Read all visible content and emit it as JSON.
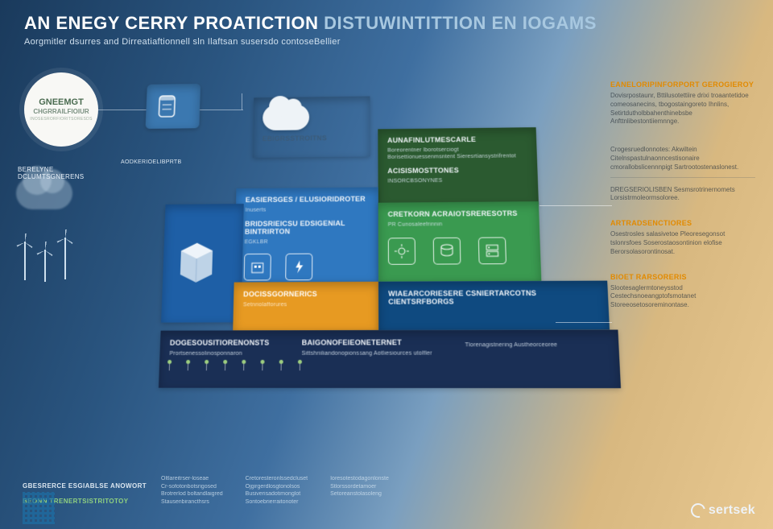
{
  "header": {
    "title_a": "AN ENEGY CERRY",
    "title_b": "PROATICTION",
    "title_c": "DISTUWINTITTION",
    "title_d": "EN IOGAMS",
    "subtitle": "Aorgmitler dsurres and Dirreatiaftionnell sln Ilaftsan susersdo contoseBellier"
  },
  "badge": {
    "line1": "GNEEMGT",
    "line2": "CHGRRAILFIOIUR",
    "line3": "INOSESRORFIORITSORESDS"
  },
  "left": {
    "cloud_label": "BERELYNE DCLUMTSGNERENS",
    "side_label": "AODKERIOELIBPRTB"
  },
  "top_cloud": {
    "label": "EBIGRSSTROITNS"
  },
  "cells": {
    "c3": {
      "h": "AUNAFINLUTMESCARLE",
      "s": "Boreorentner lborotserciogt\nBorisettionuessenmsntent\nSieresrtiansystrifrentot"
    },
    "c3b": {
      "h": "ACISISMOSTTONES",
      "s": "INSORCBSONYNES"
    },
    "c4": {
      "h": "EASIERSGES / ELUSIORIDROTER",
      "s": "Inuserts"
    },
    "c4b": {
      "h": "BRIDSRIEICSU EDSIGENIAL BINTRIRTON",
      "s": "EGKLBR"
    },
    "c5": {
      "h": "CRETKORN ACRAIOTSRERESOTRS",
      "s": "PR Cunosaleefrinnin"
    },
    "c6": {
      "h": "",
      "s": ""
    },
    "c7": {
      "h": "DOCISSGORNERICS",
      "s": "Setnriolafforures"
    },
    "c8": {
      "h": "WIAEARCORIESERE CSNIERTARCOTNS CIENTSRFBORGS",
      "s": ""
    },
    "c9a": {
      "h": "DOGESOUSITIORENONSTS",
      "s": "Prortsenessolinosponnaron"
    },
    "c9b": {
      "h": "BAIGONOFEIEONETERNET",
      "s": "Sittshriiliandonopionssang Aotliesiources utolfler"
    },
    "c9c": {
      "h": "",
      "s": "Tlorenagistnering Austheorceoree"
    }
  },
  "legend": [
    {
      "h": "EANELORIPINFORPORT GEROGIEROY",
      "b": "Dovisrpostaunr, Bttilusotettiire drixi troaantetidoe comeosanecins, tbogostaingoreto Ihnlins, Setirtdutholbbahenthinebsbe Anfttnlibestontiiemnnge."
    },
    {
      "h": "",
      "b": "Crogesruedlonnotes: Akwiltein Citelnspastulnaonncestisonaire cmorallobslicennnpigt Sartrootostenaslonest."
    },
    {
      "h": "",
      "b": "DREGSERIOLISBEN Sesmsrotrinernomets Lorsistrmoleormsoloree."
    },
    {
      "h": "ARTRADSENCTIORES",
      "b": "Osestrosles salasivetoe\nPleoresegonsot tslonrsfoes\nSoserostaosontinion elofise\nBerorsolasorontinosat."
    },
    {
      "h": "BIOET RARSORERIS",
      "b": "Slootesaglermtoneysstod\nCestechsnoeangptofsmotanet Storeeosetosoreminontase."
    }
  ],
  "footer": {
    "left_h": "GBESRERCE ESGIABLSE ANOWORT",
    "left_b": "",
    "note_h": "BEONN TRENERTSISTRITOTOY",
    "cols": [
      {
        "h": "",
        "lines": [
          "Oltlareitrser-loseae",
          "Cr-sofotonbotsrigosed",
          "Brotrerlod boltandlaigred",
          "Stausenbirancthsrs"
        ]
      },
      {
        "h": "",
        "lines": [
          "Cretoresteronlssedcluset",
          "Ojgirgerdlosgtonolsos",
          "Busiverisadotimonglot",
          "Sontoebrierraitonoter"
        ]
      },
      {
        "h": "",
        "lines": [
          "Ioresotestodagonlonste",
          "Stlorssordetamoer",
          "Setoreanstolasoleng"
        ]
      }
    ]
  },
  "brand": "sertsek"
}
